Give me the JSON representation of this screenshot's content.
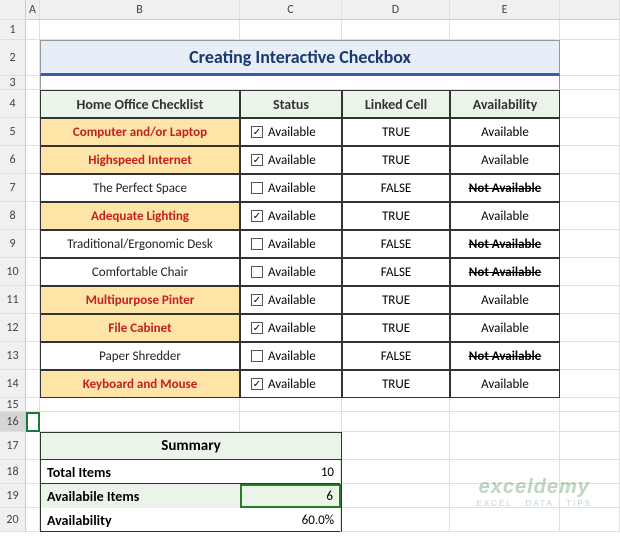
{
  "cols": [
    "A",
    "B",
    "C",
    "D",
    "E"
  ],
  "rowNums": [
    1,
    2,
    3,
    4,
    5,
    6,
    7,
    8,
    9,
    10,
    11,
    12,
    13,
    14,
    15,
    16,
    17,
    18,
    19,
    20
  ],
  "title": "Creating Interactive Checkbox",
  "headers": {
    "item": "Home Office Checklist",
    "status": "Status",
    "linked": "Linked Cell",
    "avail": "Availability"
  },
  "statusLabel": "Available",
  "rows": [
    {
      "item": "Computer and/or Laptop",
      "hl": true,
      "checked": true,
      "linked": "TRUE",
      "avail": "Available",
      "strike": false
    },
    {
      "item": "Highspeed Internet",
      "hl": true,
      "checked": true,
      "linked": "TRUE",
      "avail": "Available",
      "strike": false
    },
    {
      "item": "The Perfect Space",
      "hl": false,
      "checked": false,
      "linked": "FALSE",
      "avail": "Not Available",
      "strike": true
    },
    {
      "item": "Adequate Lighting",
      "hl": true,
      "checked": true,
      "linked": "TRUE",
      "avail": "Available",
      "strike": false
    },
    {
      "item": "Traditional/Ergonomic Desk",
      "hl": false,
      "checked": false,
      "linked": "FALSE",
      "avail": "Not Available",
      "strike": true
    },
    {
      "item": "Comfortable Chair",
      "hl": false,
      "checked": false,
      "linked": "FALSE",
      "avail": "Not Available",
      "strike": true
    },
    {
      "item": "Multipurpose Pinter",
      "hl": true,
      "checked": true,
      "linked": "TRUE",
      "avail": "Available",
      "strike": false
    },
    {
      "item": "File Cabinet",
      "hl": true,
      "checked": true,
      "linked": "TRUE",
      "avail": "Available",
      "strike": false
    },
    {
      "item": "Paper Shredder",
      "hl": false,
      "checked": false,
      "linked": "FALSE",
      "avail": "Not Available",
      "strike": true
    },
    {
      "item": "Keyboard and Mouse",
      "hl": true,
      "checked": true,
      "linked": "TRUE",
      "avail": "Available",
      "strike": false
    }
  ],
  "summary": {
    "title": "Summary",
    "totalLabel": "Total Items",
    "totalVal": "10",
    "availLabel": "Availabile Items",
    "availVal": "6",
    "pctLabel": "Availability",
    "pctVal": "60.0%"
  },
  "watermark": {
    "line1": "exceldemy",
    "line2": "EXCEL · DATA · TIPS"
  },
  "chart_data": {
    "type": "table",
    "title": "Creating Interactive Checkbox",
    "columns": [
      "Home Office Checklist",
      "Status",
      "Linked Cell",
      "Availability"
    ],
    "rows": [
      [
        "Computer and/or Laptop",
        "checked",
        "TRUE",
        "Available"
      ],
      [
        "Highspeed Internet",
        "checked",
        "TRUE",
        "Available"
      ],
      [
        "The Perfect Space",
        "unchecked",
        "FALSE",
        "Not Available"
      ],
      [
        "Adequate Lighting",
        "checked",
        "TRUE",
        "Available"
      ],
      [
        "Traditional/Ergonomic Desk",
        "unchecked",
        "FALSE",
        "Not Available"
      ],
      [
        "Comfortable Chair",
        "unchecked",
        "FALSE",
        "Not Available"
      ],
      [
        "Multipurpose Pinter",
        "checked",
        "TRUE",
        "Available"
      ],
      [
        "File Cabinet",
        "checked",
        "TRUE",
        "Available"
      ],
      [
        "Paper Shredder",
        "unchecked",
        "FALSE",
        "Not Available"
      ],
      [
        "Keyboard and Mouse",
        "checked",
        "TRUE",
        "Available"
      ]
    ],
    "summary": {
      "Total Items": 10,
      "Availabile Items": 6,
      "Availability": "60.0%"
    }
  }
}
